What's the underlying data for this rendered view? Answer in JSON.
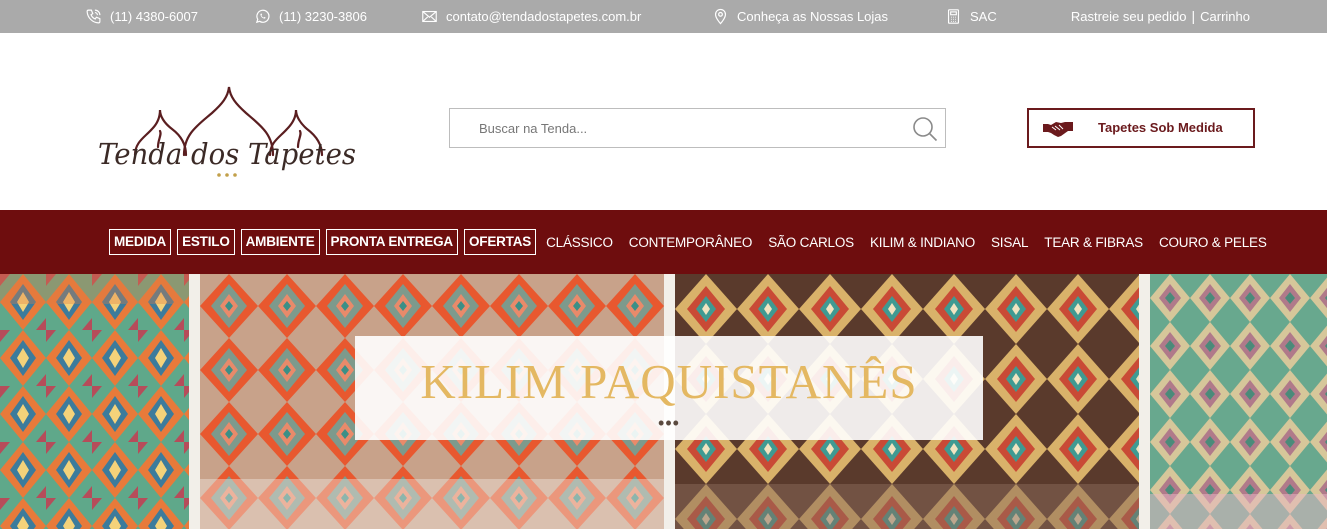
{
  "topbar": {
    "phone": "(11) 4380-6007",
    "whatsapp": "(11) 3230-3806",
    "email": "contato@tendadostapetes.com.br",
    "stores": "Conheça as Nossas Lojas",
    "sac": "SAC",
    "track_order": "Rastreie seu pedido",
    "separator": "|",
    "cart": "Carrinho"
  },
  "header": {
    "logo_text": "Tenda dos Tapetes",
    "search_placeholder": "Buscar na Tenda...",
    "custom_button": "Tapetes Sob Medida"
  },
  "nav": {
    "boxed": [
      "MEDIDA",
      "ESTILO",
      "AMBIENTE",
      "PRONTA ENTREGA",
      "OFERTAS"
    ],
    "links": [
      "CLÁSSICO",
      "CONTEMPORÂNEO",
      "SÃO CARLOS",
      "KILIM & INDIANO",
      "SISAL",
      "TEAR & FIBRAS",
      "COURO & PELES"
    ]
  },
  "banner": {
    "title": "KILIM PAQUISTANÊS",
    "dots": "•••"
  },
  "colors": {
    "topbar_bg": "#aaaaaa",
    "nav_bg": "#6e0d0e",
    "brand_dark": "#6b1a1d",
    "logo_gold": "#c2a04a",
    "banner_title": "#e4b862"
  },
  "icons": [
    "phone-icon",
    "whatsapp-icon",
    "mail-icon",
    "map-pin-icon",
    "calculator-icon",
    "search-icon",
    "handshake-icon"
  ]
}
